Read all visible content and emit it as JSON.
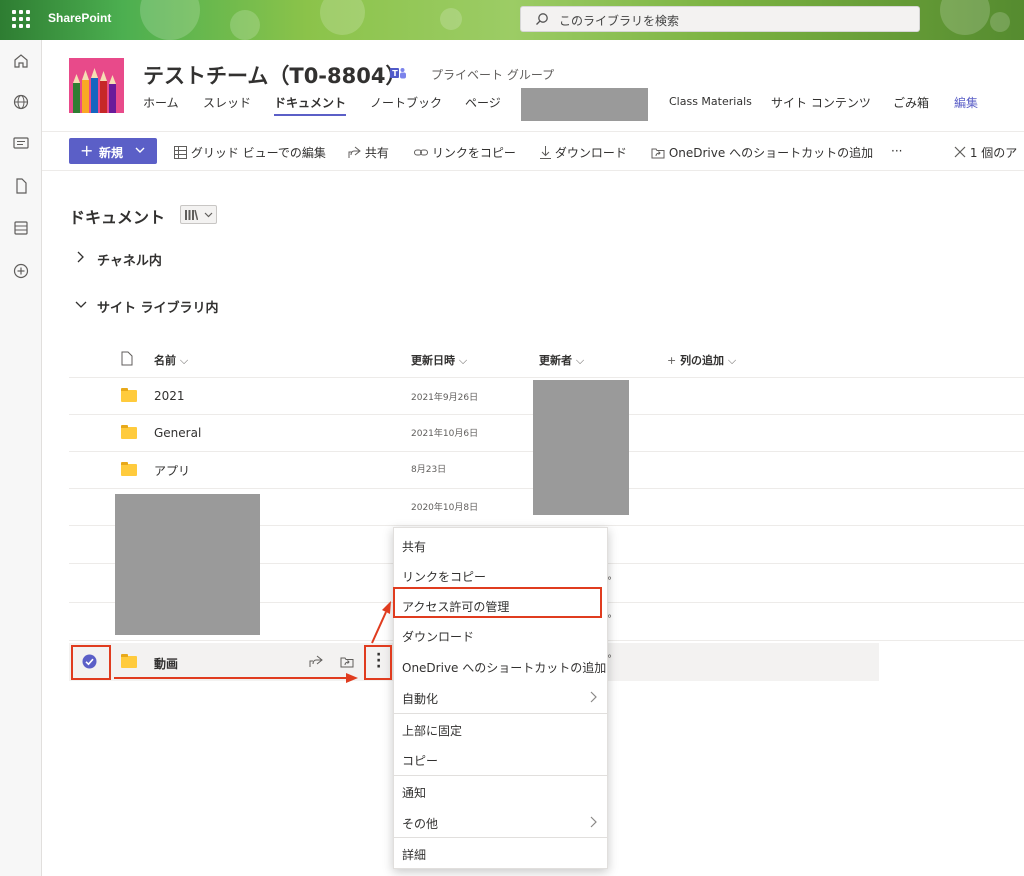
{
  "suitebar": {
    "brand": "SharePoint",
    "search_placeholder": "このライブラリを検索"
  },
  "site": {
    "title": "テストチーム（T0-8804）",
    "privacy": "プライベート グループ",
    "nav": [
      "ホーム",
      "スレッド",
      "ドキュメント",
      "ノートブック",
      "ページ",
      "Class Materials",
      "サイト コンテンツ",
      "ごみ箱",
      "編集"
    ]
  },
  "commandbar": {
    "new_label": "新規",
    "grid_edit": "グリッド ビューでの編集",
    "share": "共有",
    "copy_link": "リンクをコピー",
    "download": "ダウンロード",
    "onedrive_shortcut": "OneDrive へのショートカットの追加",
    "more": "···",
    "selection": "1 個のア"
  },
  "library": {
    "title": "ドキュメント",
    "section_channel": "チャネル内",
    "section_site": "サイト ライブラリ内",
    "columns": {
      "name": "名前",
      "modified": "更新日時",
      "modified_by": "更新者",
      "add_column": "列の追加"
    },
    "rows": [
      {
        "name": "2021",
        "date": "2021年9月26日"
      },
      {
        "name": "General",
        "date": "2021年10月6日"
      },
      {
        "name": "アプリ",
        "date": "8月23日"
      },
      {
        "name": "",
        "date": "2020年10月8日"
      }
    ],
    "selected_row": {
      "name": "動画"
    }
  },
  "context_menu": {
    "items": [
      "共有",
      "リンクをコピー",
      "アクセス許可の管理",
      "ダウンロード",
      "OneDrive へのショートカットの追加",
      "自動化",
      "上部に固定",
      "コピー",
      "通知",
      "その他",
      "詳細"
    ]
  },
  "colors": {
    "accent": "#5b5fc7",
    "annotation": "#e03c1f",
    "folder": "#ffcb3d"
  }
}
